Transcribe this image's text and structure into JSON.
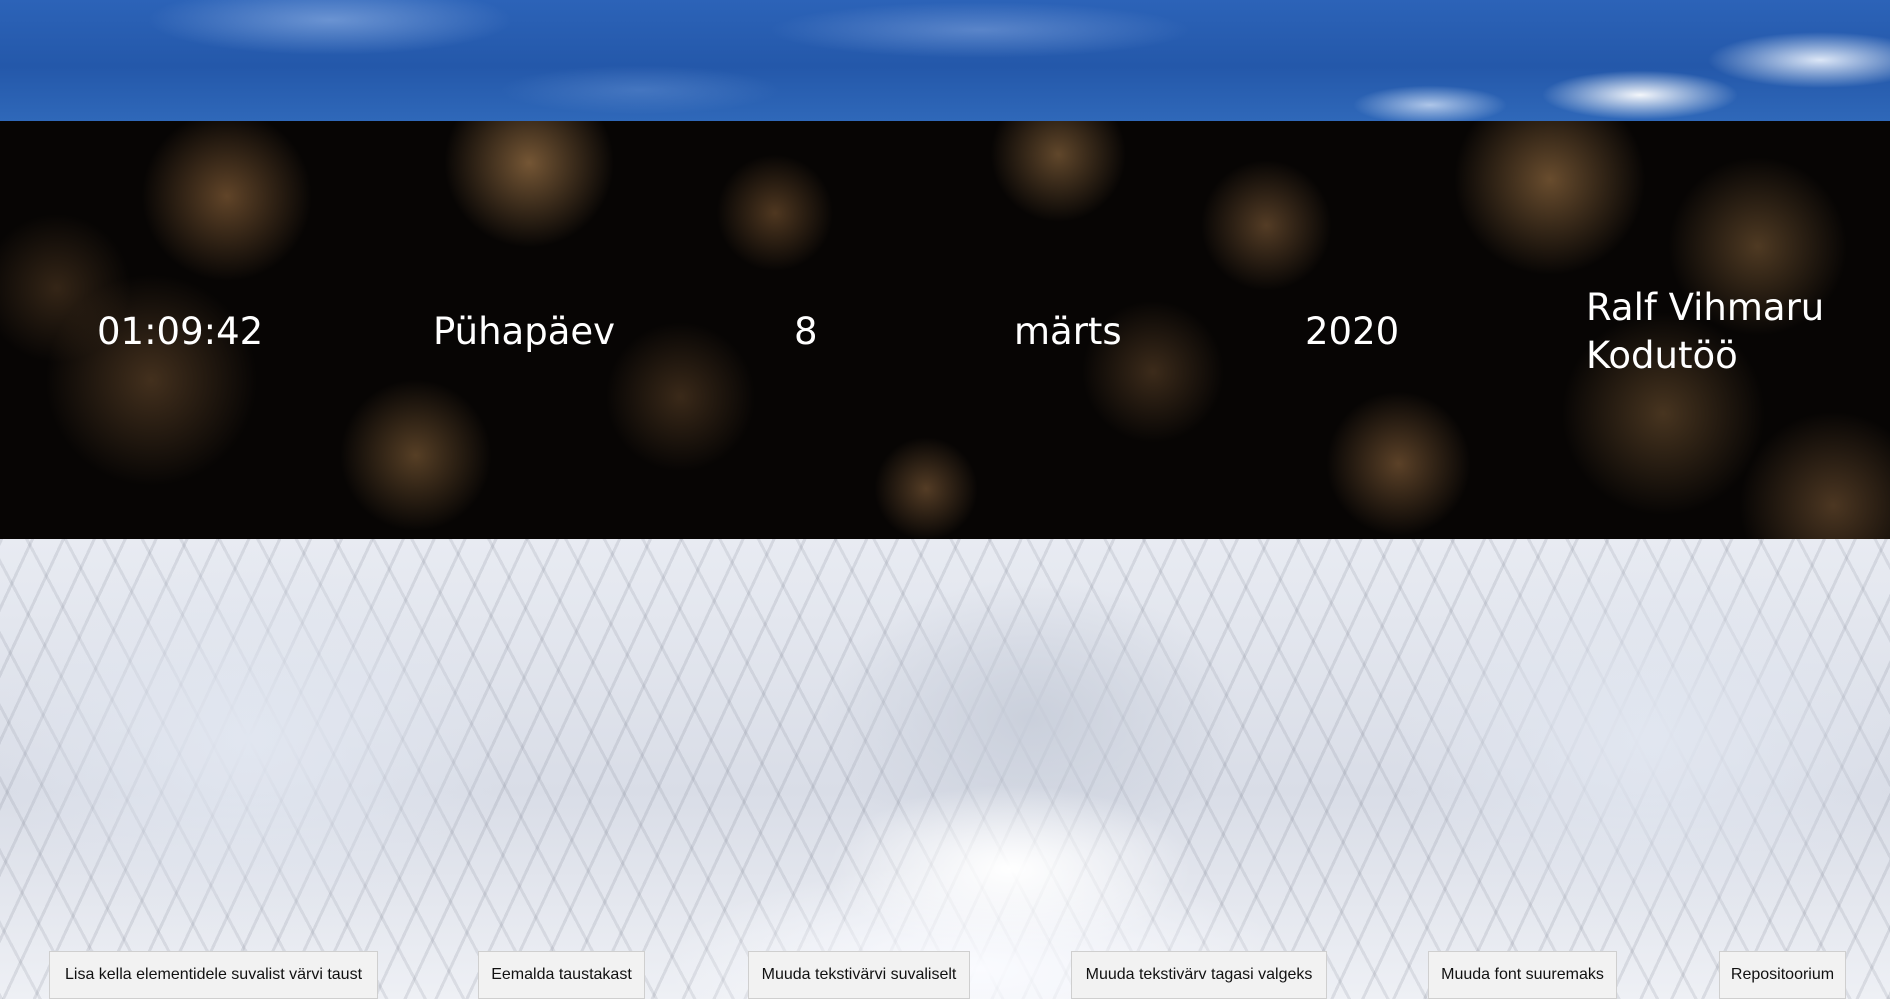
{
  "clock": {
    "time": "01:09:42",
    "weekday": "Pühapäev",
    "day": "8",
    "month": "märts",
    "year": "2020"
  },
  "credits": {
    "author": "Ralf Vihmaru",
    "subtitle": "Kodutöö"
  },
  "buttons": {
    "random_bg": "Lisa kella elementidele suvalist värvi taust",
    "remove_bg": "Eemalda taustakast",
    "random_text_color": "Muuda tekstivärvi suvaliselt",
    "reset_text_color": "Muuda tekstivärv tagasi valgeks",
    "font_size": "Muuda font suuremaks",
    "repository": "Repositoorium"
  },
  "colors": {
    "flag_blue": "#2458aa",
    "flag_black": "#070504",
    "flag_white": "#e8ebf2",
    "text": "#ffffff"
  }
}
